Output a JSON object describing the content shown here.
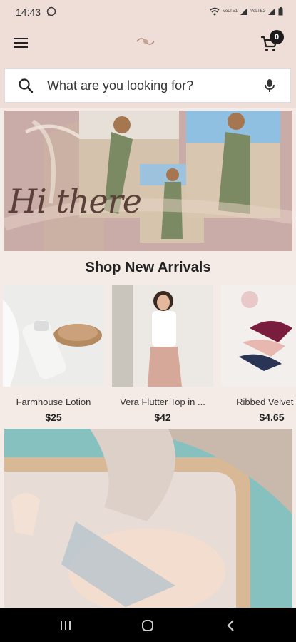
{
  "status_bar": {
    "time": "14:43",
    "sim1": "VoLTE1",
    "sim2": "VoLTE2"
  },
  "header": {
    "cart_count": "0"
  },
  "search": {
    "placeholder": "What are you looking for?"
  },
  "hero": {
    "text": "Hi there"
  },
  "section": {
    "title": "Shop New Arrivals"
  },
  "products": [
    {
      "name": "Farmhouse Lotion",
      "price": "$25"
    },
    {
      "name": "Vera Flutter Top in ...",
      "price": "$42"
    },
    {
      "name": "Ribbed Velvet Bo",
      "price": "$4.65"
    }
  ],
  "colors": {
    "header_bg": "#eeded7",
    "hero_bg": "#c9aba8",
    "nav_bg": "#000000"
  }
}
